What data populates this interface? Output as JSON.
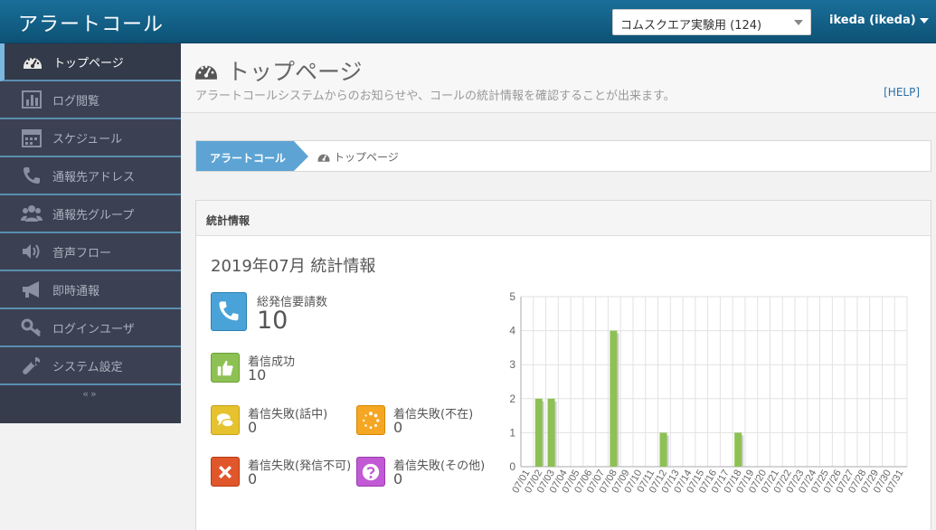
{
  "app": {
    "brand": "アラートコール"
  },
  "topbar": {
    "account_select": "コムスクエア実験用 (124)",
    "user": "ikeda (ikeda)"
  },
  "sidebar": {
    "items": [
      {
        "label": "トップページ",
        "icon": "dashboard-icon"
      },
      {
        "label": "ログ閲覧",
        "icon": "bar-chart-icon"
      },
      {
        "label": "スケジュール",
        "icon": "calendar-icon"
      },
      {
        "label": "通報先アドレス",
        "icon": "phone-icon"
      },
      {
        "label": "通報先グループ",
        "icon": "group-icon"
      },
      {
        "label": "音声フロー",
        "icon": "speaker-icon"
      },
      {
        "label": "即時通報",
        "icon": "megaphone-icon"
      },
      {
        "label": "ログインユーザ",
        "icon": "key-icon"
      },
      {
        "label": "システム設定",
        "icon": "wrench-icon"
      }
    ],
    "collapse": "«»"
  },
  "header": {
    "title": "トップページ",
    "description": "アラートコールシステムからのお知らせや、コールの統計情報を確認することが出来ます。",
    "help": "[HELP]"
  },
  "breadcrumb": {
    "first": "アラートコール",
    "second": "トップページ"
  },
  "panel": {
    "heading": "統計情報",
    "title": "2019年07月 統計情報",
    "total": {
      "label": "総発信要請数",
      "value": "10",
      "color": "#4aa3d8"
    },
    "success": {
      "label": "着信成功",
      "value": "10",
      "color": "#8dc153"
    },
    "busy": {
      "label": "着信失敗(話中)",
      "value": "0",
      "color": "#e5c22e"
    },
    "absent": {
      "label": "着信失敗(不在)",
      "value": "0",
      "color": "#f5a623"
    },
    "cannot_call": {
      "label": "着信失敗(発信不可)",
      "value": "0",
      "color": "#e0572b"
    },
    "other": {
      "label": "着信失敗(その他)",
      "value": "0",
      "color": "#c15ad4"
    }
  },
  "chart_data": {
    "type": "bar",
    "categories": [
      "07/01",
      "07/02",
      "07/03",
      "07/04",
      "07/05",
      "07/06",
      "07/07",
      "07/08",
      "07/09",
      "07/10",
      "07/11",
      "07/12",
      "07/13",
      "07/14",
      "07/15",
      "07/16",
      "07/17",
      "07/18",
      "07/19",
      "07/20",
      "07/21",
      "07/22",
      "07/23",
      "07/24",
      "07/25",
      "07/26",
      "07/27",
      "07/28",
      "07/29",
      "07/30",
      "07/31"
    ],
    "values": [
      0,
      2,
      2,
      0,
      0,
      0,
      0,
      4,
      0,
      0,
      0,
      1,
      0,
      0,
      0,
      0,
      0,
      1,
      0,
      0,
      0,
      0,
      0,
      0,
      0,
      0,
      0,
      0,
      0,
      0,
      0
    ],
    "yticks": [
      "0",
      "1",
      "2",
      "3",
      "4",
      "5"
    ],
    "ylim": [
      0,
      5
    ],
    "grid": true,
    "bar_color": "#8dc153"
  }
}
